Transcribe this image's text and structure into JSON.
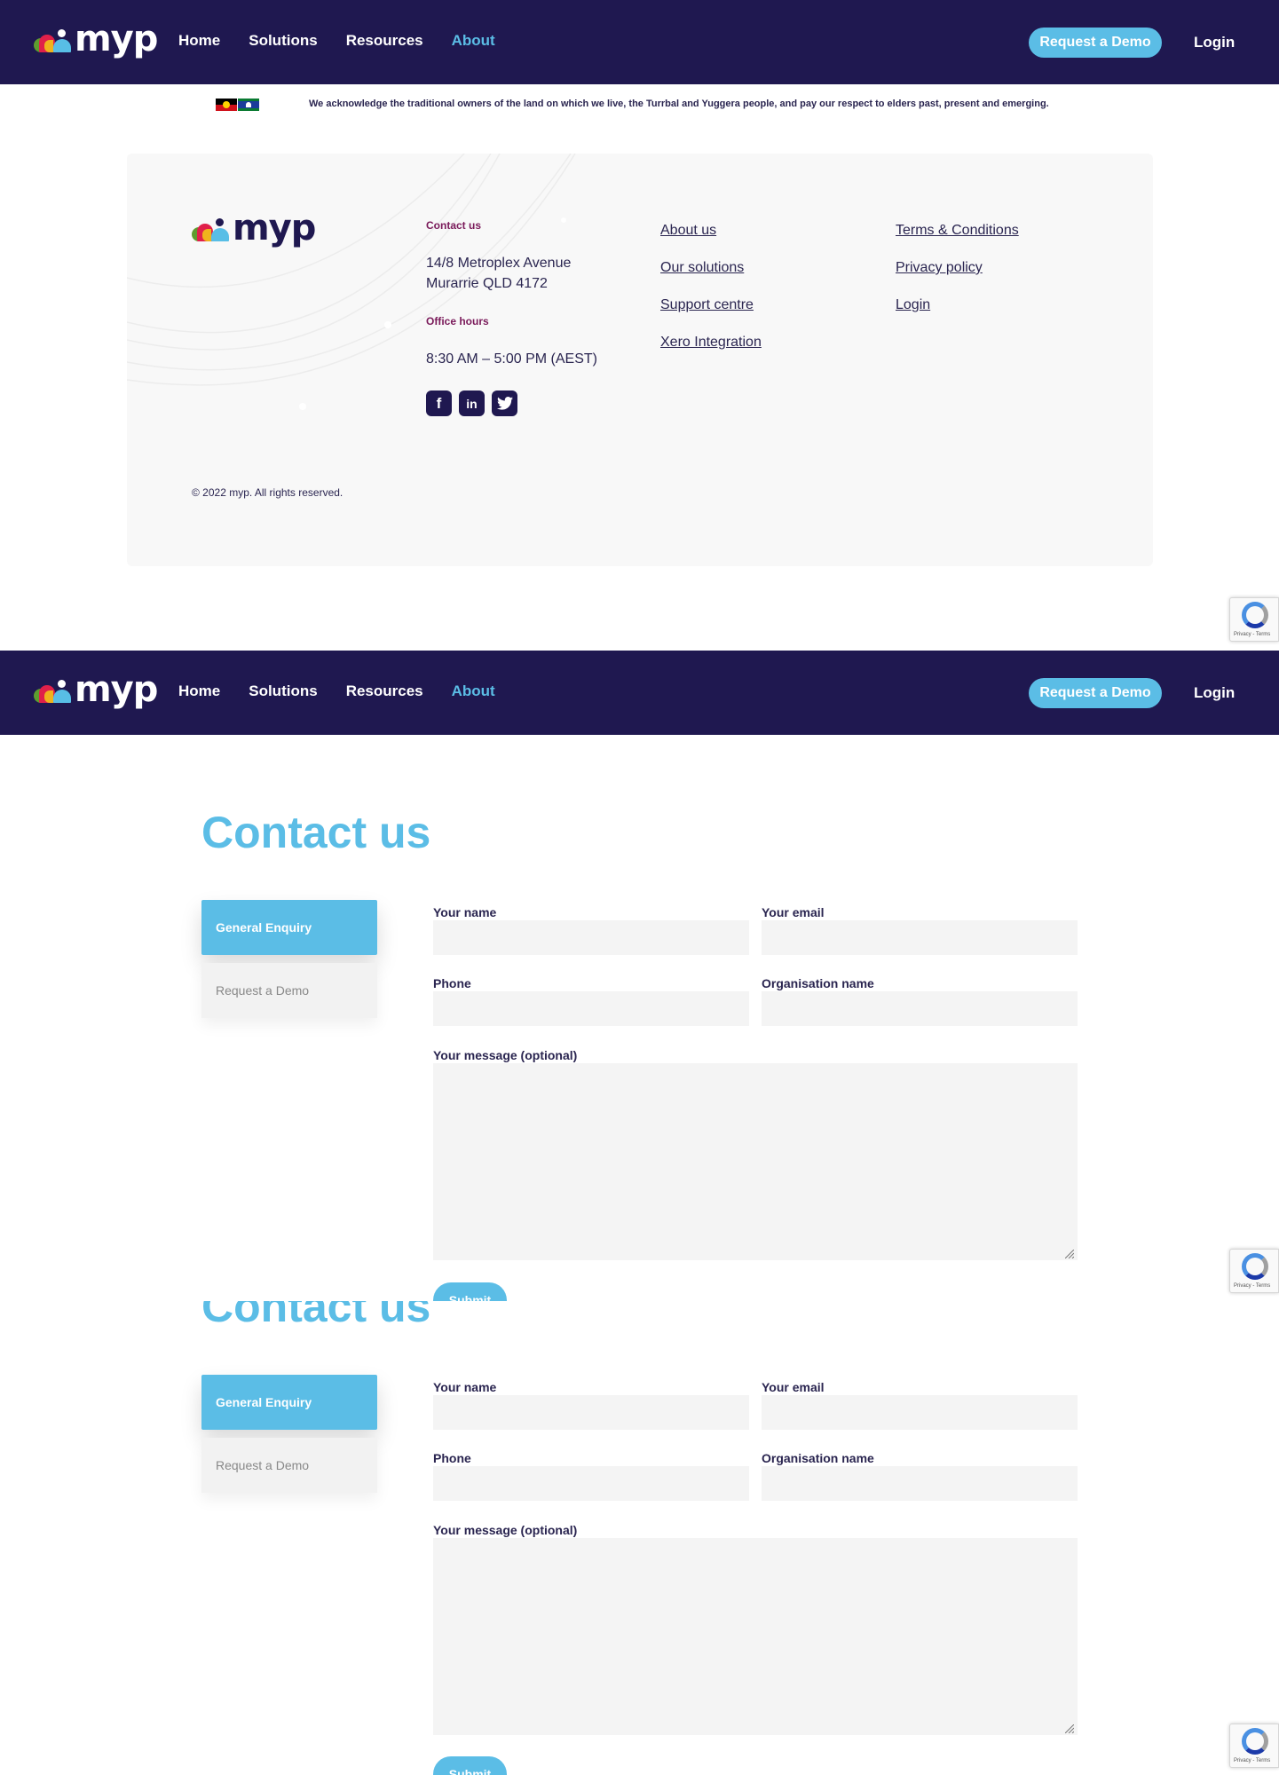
{
  "nav": {
    "logo": "myp",
    "links": [
      "Home",
      "Solutions",
      "Resources",
      "About"
    ],
    "active": "About",
    "demo_button": "Request a Demo",
    "login": "Login"
  },
  "acknowledgement": "We acknowledge the traditional owners of the land on which we live, the Turrbal and Yuggera people, and pay our respect to elders past, present and emerging.",
  "footer": {
    "logo": "myp",
    "contact_heading": "Contact us",
    "address_line1": "14/8 Metroplex Avenue",
    "address_line2": "Murarrie QLD 4172",
    "hours_heading": "Office hours",
    "hours": "8:30 AM – 5:00 PM (AEST)",
    "links_col1": [
      "About us",
      "Our solutions",
      "Support centre",
      "Xero Integration"
    ],
    "links_col2": [
      "Terms & Conditions",
      "Privacy policy",
      "Login"
    ],
    "social": [
      "facebook-icon",
      "linkedin-icon",
      "twitter-icon"
    ],
    "copyright": "© 2022 myp.  All rights reserved."
  },
  "recaptcha": {
    "text": "Privacy - Terms"
  },
  "contact": {
    "title": "Contact us",
    "tabs": [
      "General Enquiry",
      "Request a Demo"
    ],
    "fields": {
      "name": "Your name",
      "email": "Your email",
      "phone": "Phone",
      "organisation": "Organisation name",
      "message": "Your message (optional)"
    },
    "submit": "Submit"
  },
  "colors": {
    "navy": "#1f1850",
    "accent": "#5bbde6",
    "heading_maroon": "#7a1a5a"
  }
}
